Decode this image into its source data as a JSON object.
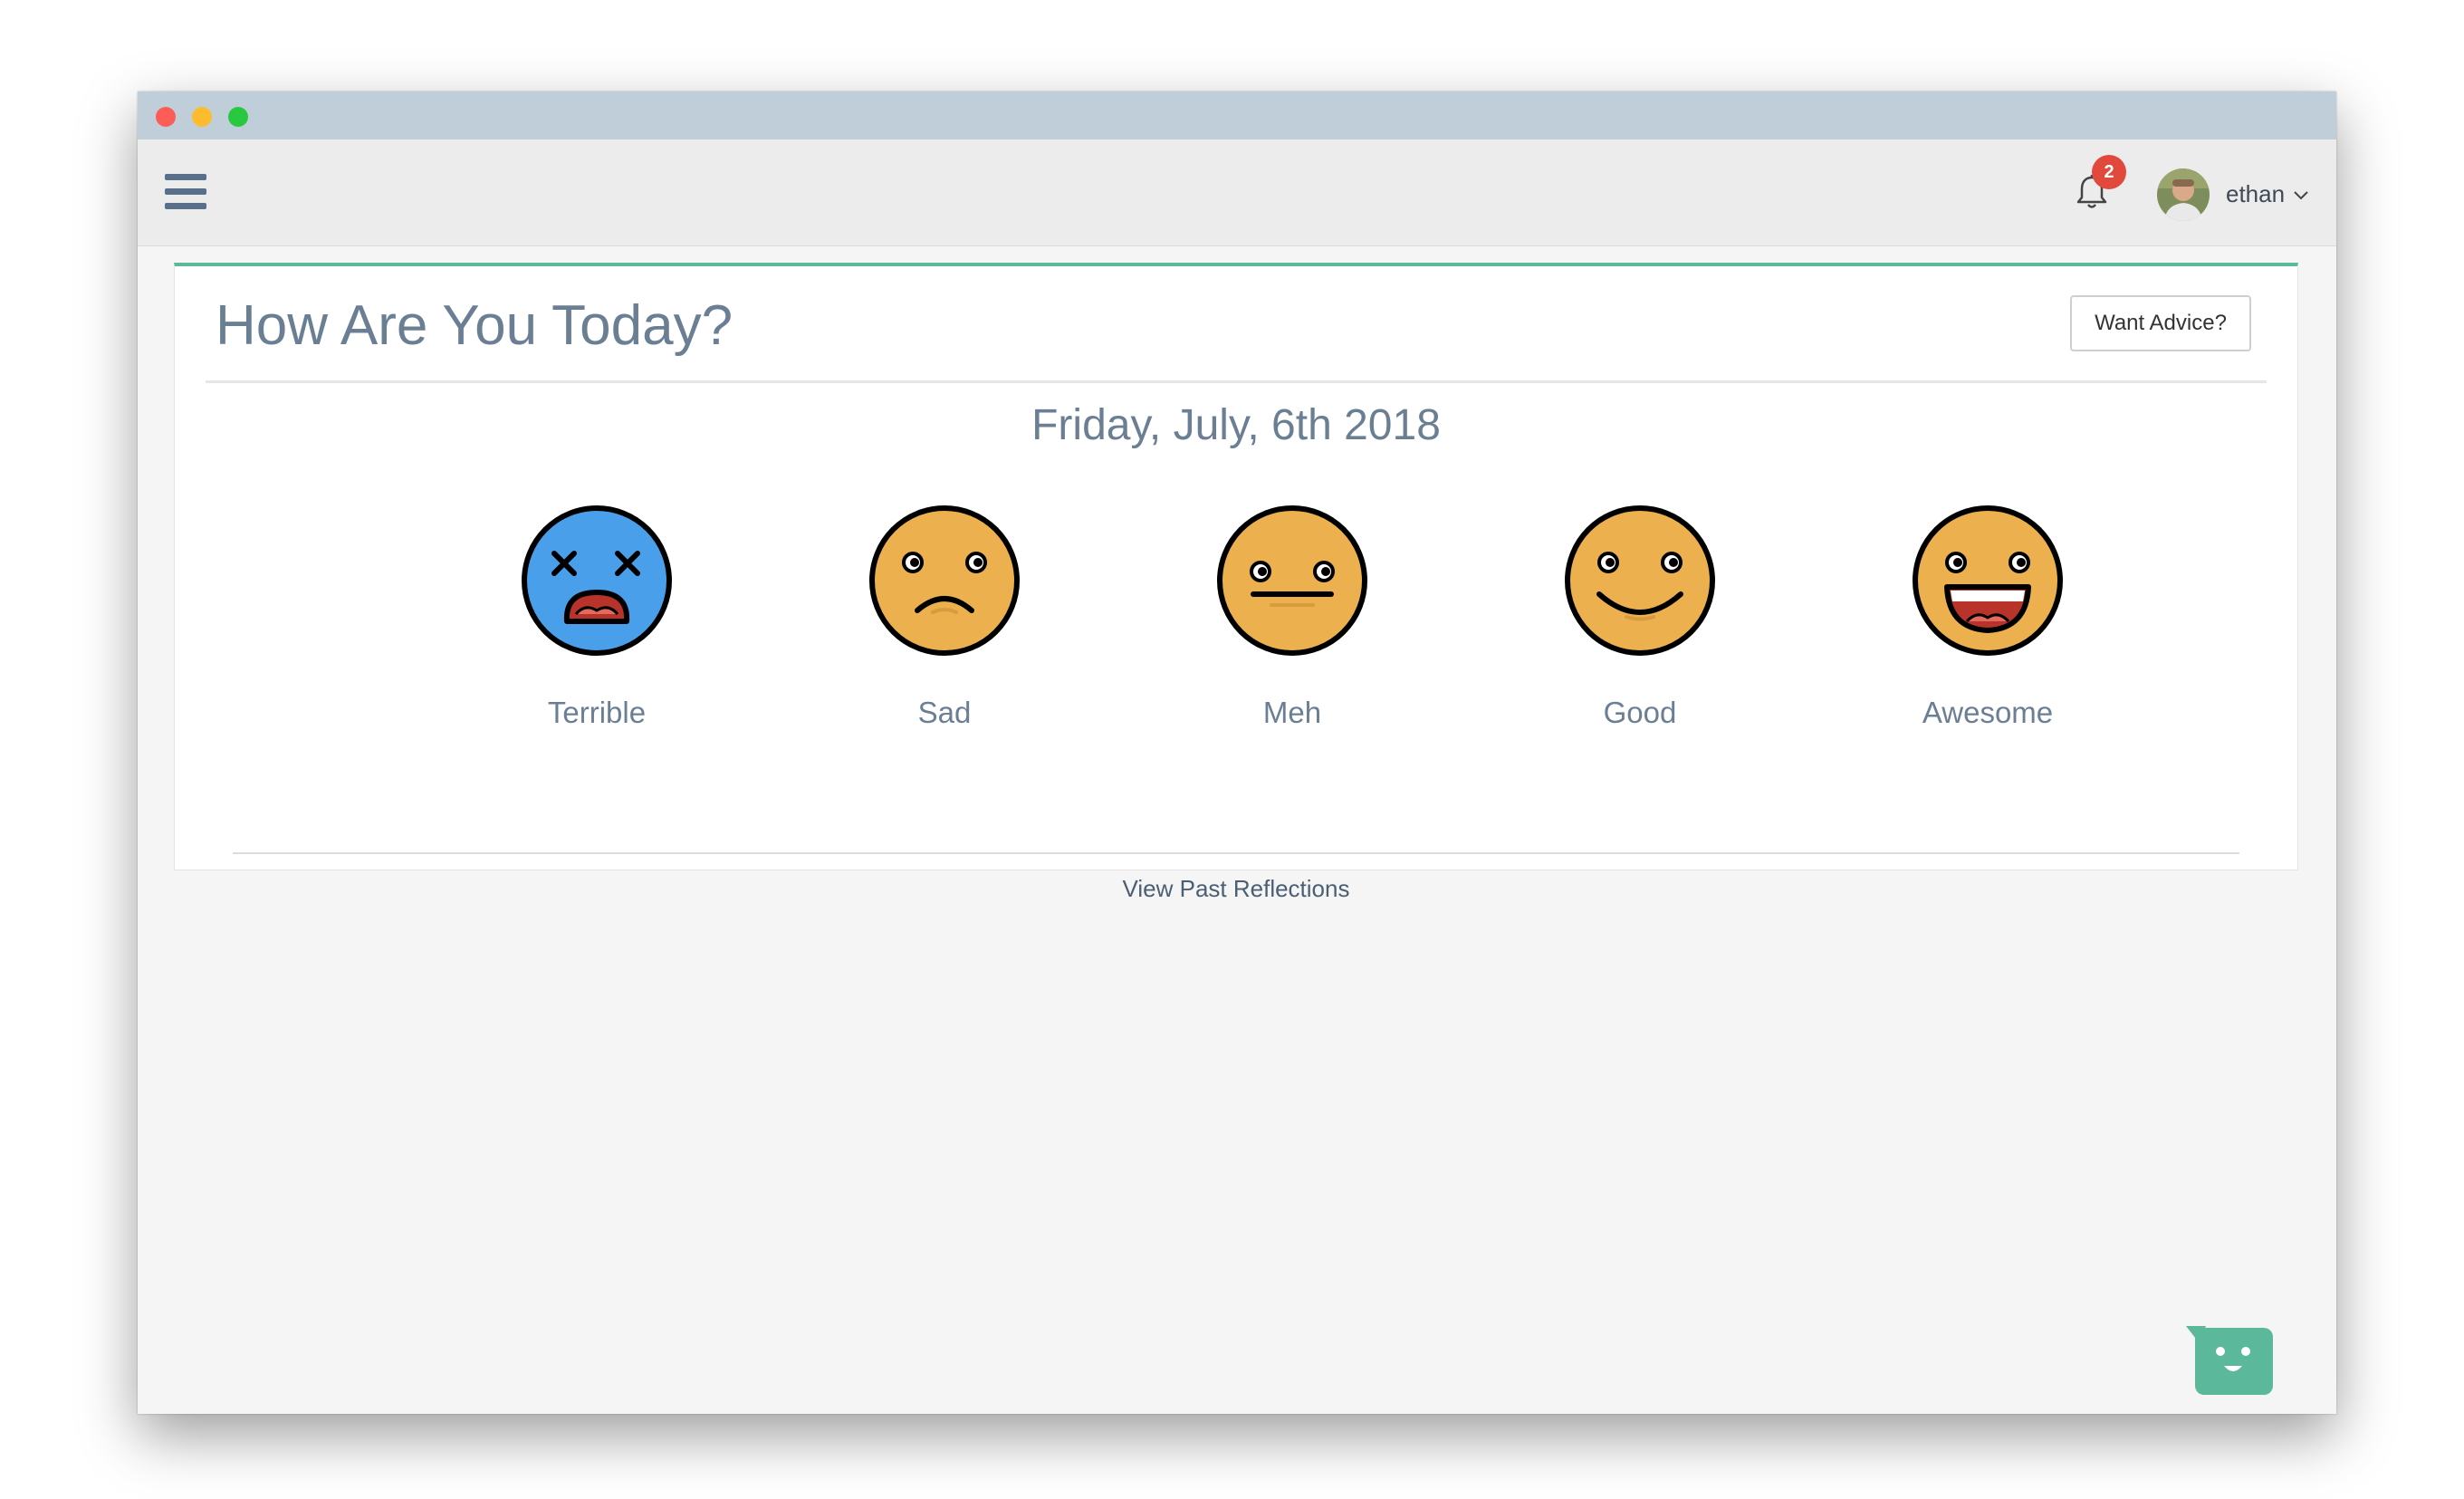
{
  "topnav": {
    "notification_count": "2",
    "username": "ethan"
  },
  "card": {
    "title": "How Are You Today?",
    "advice_button": "Want Advice?",
    "date": "Friday, July, 6th 2018",
    "moods": [
      {
        "label": "Terrible",
        "icon": "dizzy-face-icon",
        "color": "#4a9fea"
      },
      {
        "label": "Sad",
        "icon": "sad-face-icon",
        "color": "#ecb14e"
      },
      {
        "label": "Meh",
        "icon": "neutral-face-icon",
        "color": "#ecb14e"
      },
      {
        "label": "Good",
        "icon": "smiling-face-icon",
        "color": "#ecb14e"
      },
      {
        "label": "Awesome",
        "icon": "grinning-face-icon",
        "color": "#ecb14e"
      }
    ],
    "past_link": "View Past Reflections"
  },
  "colors": {
    "accent": "#5cb89a",
    "titlebar": "#c0ced9",
    "text": "#6b7f94",
    "badge": "#e0493c",
    "chat_widget": "#5cb89a"
  }
}
